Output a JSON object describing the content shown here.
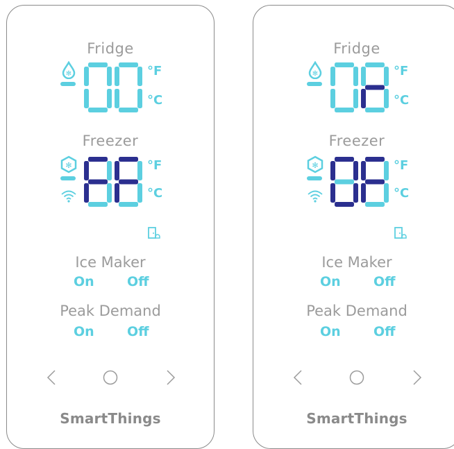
{
  "colors": {
    "lit": "#5ccfe0",
    "active": "#2b2f8f",
    "label": "#9b9b9b",
    "brand": "#8a8a8a"
  },
  "panels": [
    {
      "fridge_label": "Fridge",
      "fridge_digits": [
        {
          "on": [
            "a",
            "b",
            "c",
            "d",
            "e",
            "f"
          ],
          "active": []
        },
        {
          "on": [
            "a",
            "b",
            "c",
            "d",
            "e",
            "f"
          ],
          "active": []
        }
      ],
      "freezer_label": "Freezer",
      "freezer_digits": [
        {
          "on": [
            "a",
            "b",
            "c",
            "d",
            "e",
            "f",
            "g"
          ],
          "active": [
            "a",
            "e",
            "f",
            "g"
          ]
        },
        {
          "on": [
            "a",
            "b",
            "c",
            "d",
            "e",
            "f",
            "g"
          ],
          "active": [
            "a",
            "e",
            "f",
            "g"
          ]
        }
      ],
      "unit_f": "°F",
      "unit_c": "°C",
      "ice_maker_label": "Ice Maker",
      "ice_on": "On",
      "ice_off": "Off",
      "peak_label": "Peak Demand",
      "peak_on": "On",
      "peak_off": "Off",
      "brand": "SmartThings",
      "icons": [
        "water-drop-icon",
        "freezer-snowflake-icon",
        "wifi-icon",
        "door-alarm-icon",
        "prev-arrow-icon",
        "home-circle-icon",
        "next-arrow-icon"
      ]
    },
    {
      "fridge_label": "Fridge",
      "fridge_digits": [
        {
          "on": [
            "a",
            "b",
            "c",
            "d",
            "e",
            "f"
          ],
          "active": []
        },
        {
          "on": [
            "a",
            "b",
            "c",
            "d",
            "e",
            "f",
            "g"
          ],
          "active": [
            "e",
            "g"
          ]
        }
      ],
      "freezer_label": "Freezer",
      "freezer_digits": [
        {
          "on": [
            "a",
            "b",
            "c",
            "d",
            "e",
            "f",
            "g"
          ],
          "active": [
            "a",
            "b",
            "c",
            "d",
            "e",
            "f"
          ]
        },
        {
          "on": [
            "a",
            "b",
            "c",
            "d",
            "e",
            "f",
            "g"
          ],
          "active": [
            "a",
            "e",
            "f",
            "g"
          ]
        }
      ],
      "unit_f": "°F",
      "unit_c": "°C",
      "ice_maker_label": "Ice Maker",
      "ice_on": "On",
      "ice_off": "Off",
      "peak_label": "Peak Demand",
      "peak_on": "On",
      "peak_off": "Off",
      "brand": "SmartThings",
      "icons": [
        "water-drop-icon",
        "freezer-snowflake-icon",
        "wifi-icon",
        "door-alarm-icon",
        "prev-arrow-icon",
        "home-circle-icon",
        "next-arrow-icon"
      ]
    }
  ]
}
